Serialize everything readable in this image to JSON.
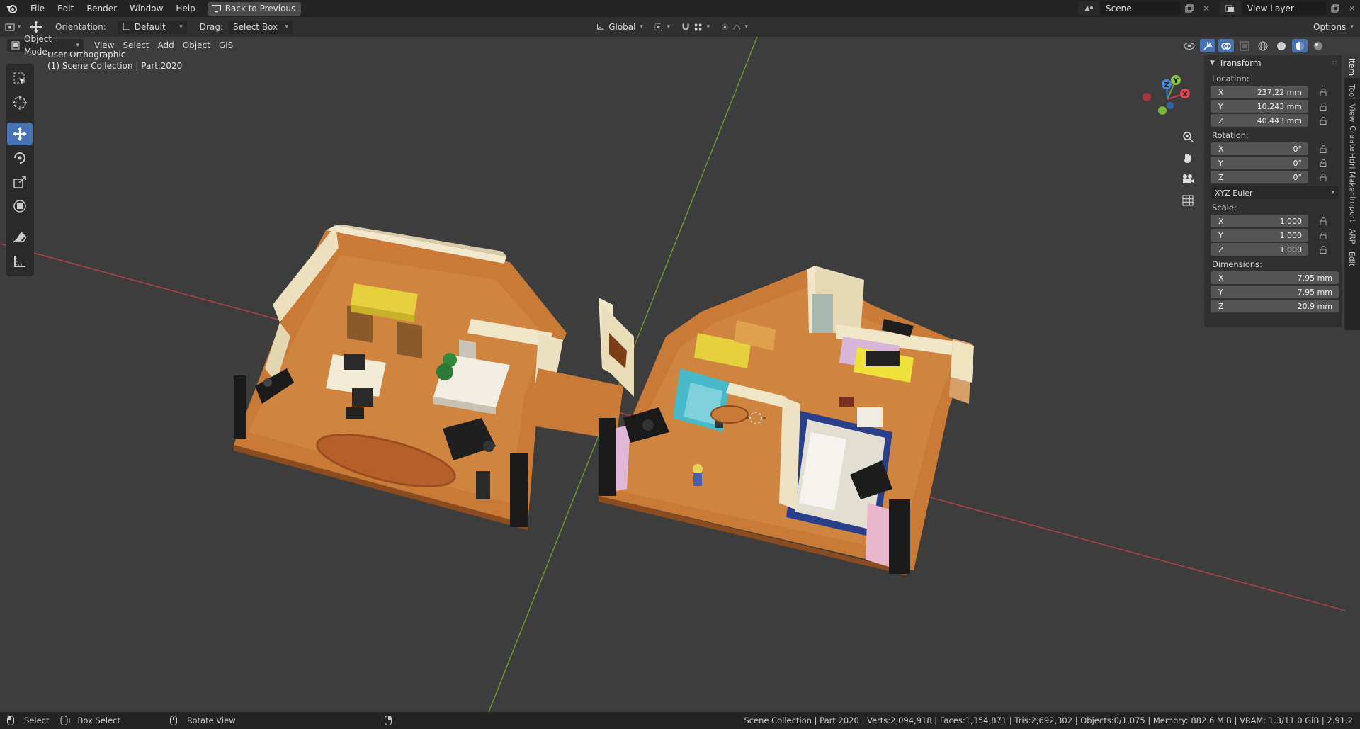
{
  "menu": {
    "items": [
      "File",
      "Edit",
      "Render",
      "Window",
      "Help"
    ],
    "back_label": "Back to Previous"
  },
  "scene": {
    "name": "Scene",
    "view_layer": "View Layer",
    "options_label": "Options"
  },
  "tool_header": {
    "orientation_label": "Orientation:",
    "orientation_value": "Default",
    "drag_label": "Drag:",
    "drag_value": "Select Box",
    "transform_space": "Global"
  },
  "viewport_header": {
    "mode": "Object Mode",
    "menus": [
      "View",
      "Select",
      "Add",
      "Object",
      "GIS"
    ]
  },
  "viewport": {
    "view_name": "User Orthographic",
    "collection_info": "(1) Scene Collection | Part.2020"
  },
  "gizmo": {
    "x": "X",
    "y": "Y",
    "z": "Z"
  },
  "transform": {
    "title": "Transform",
    "location_label": "Location:",
    "location": [
      {
        "axis": "X",
        "value": "237.22 mm"
      },
      {
        "axis": "Y",
        "value": "10.243 mm"
      },
      {
        "axis": "Z",
        "value": "40.443 mm"
      }
    ],
    "rotation_label": "Rotation:",
    "rotation": [
      {
        "axis": "X",
        "value": "0°"
      },
      {
        "axis": "Y",
        "value": "0°"
      },
      {
        "axis": "Z",
        "value": "0°"
      }
    ],
    "rotation_mode": "XYZ Euler",
    "scale_label": "Scale:",
    "scale": [
      {
        "axis": "X",
        "value": "1.000"
      },
      {
        "axis": "Y",
        "value": "1.000"
      },
      {
        "axis": "Z",
        "value": "1.000"
      }
    ],
    "dimensions_label": "Dimensions:",
    "dimensions": [
      {
        "axis": "X",
        "value": "7.95 mm"
      },
      {
        "axis": "Y",
        "value": "7.95 mm"
      },
      {
        "axis": "Z",
        "value": "20.9 mm"
      }
    ]
  },
  "side_tabs": [
    "Item",
    "Tool",
    "View",
    "Create",
    "Hdri Maker",
    "Import",
    "ARP",
    "Edit"
  ],
  "status": {
    "select": "Select",
    "box_select": "Box Select",
    "rotate_view": "Rotate View",
    "info": "Scene Collection | Part.2020 | Verts:2,094,918 | Faces:1,354,871 | Tris:2,692,302 | Objects:0/1,075 | Memory: 882.6 MiB | VRAM: 1.3/11.0 GiB | 2.91.2"
  },
  "colors": {
    "accent": "#4772b3",
    "axis_x": "#cc3b4b",
    "axis_y": "#7aa33a",
    "floor": "#c97a36",
    "wall": "#e9dcb8"
  }
}
